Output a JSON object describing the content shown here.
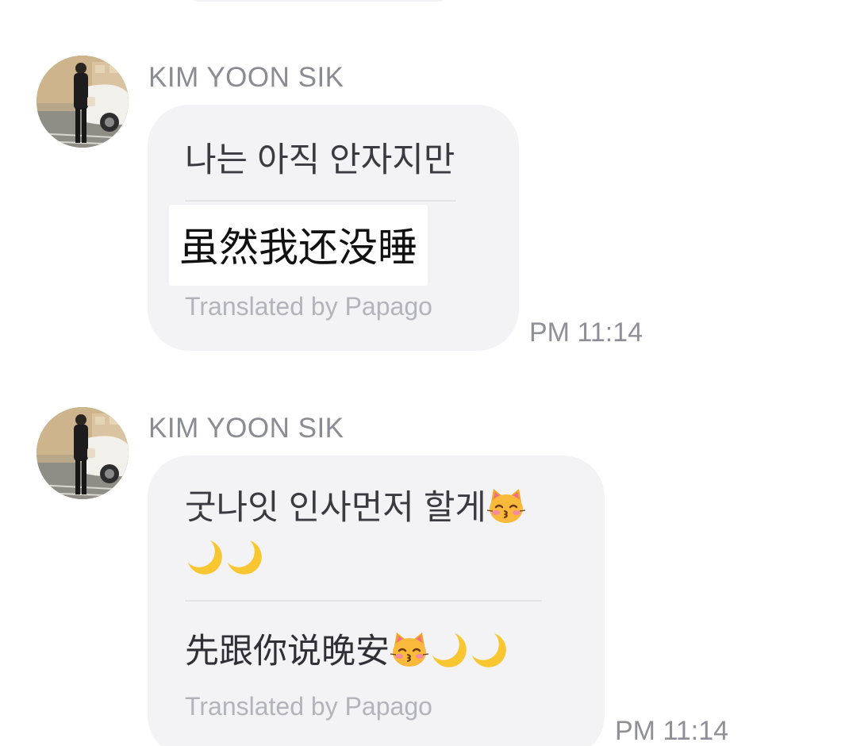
{
  "messages": [
    {
      "sender": "KIM YOON SIK",
      "original": "나는 아직 안자지만",
      "translation": "虽然我还没睡",
      "credit": "Translated by Papago",
      "time": "PM 11:14"
    },
    {
      "sender": "KIM YOON SIK",
      "original_line1": "굿나잇 인사먼저 할게",
      "translation": "先跟你说晚安",
      "credit": "Translated by Papago",
      "time": "PM 11:14",
      "emojis": [
        "kissing-cat-icon",
        "crescent-moon-icon"
      ]
    }
  ],
  "colors": {
    "bubble": "#f3f3f6",
    "sender": "#8b8b93",
    "credit": "#b3b3ba",
    "time": "#8f8f97"
  }
}
